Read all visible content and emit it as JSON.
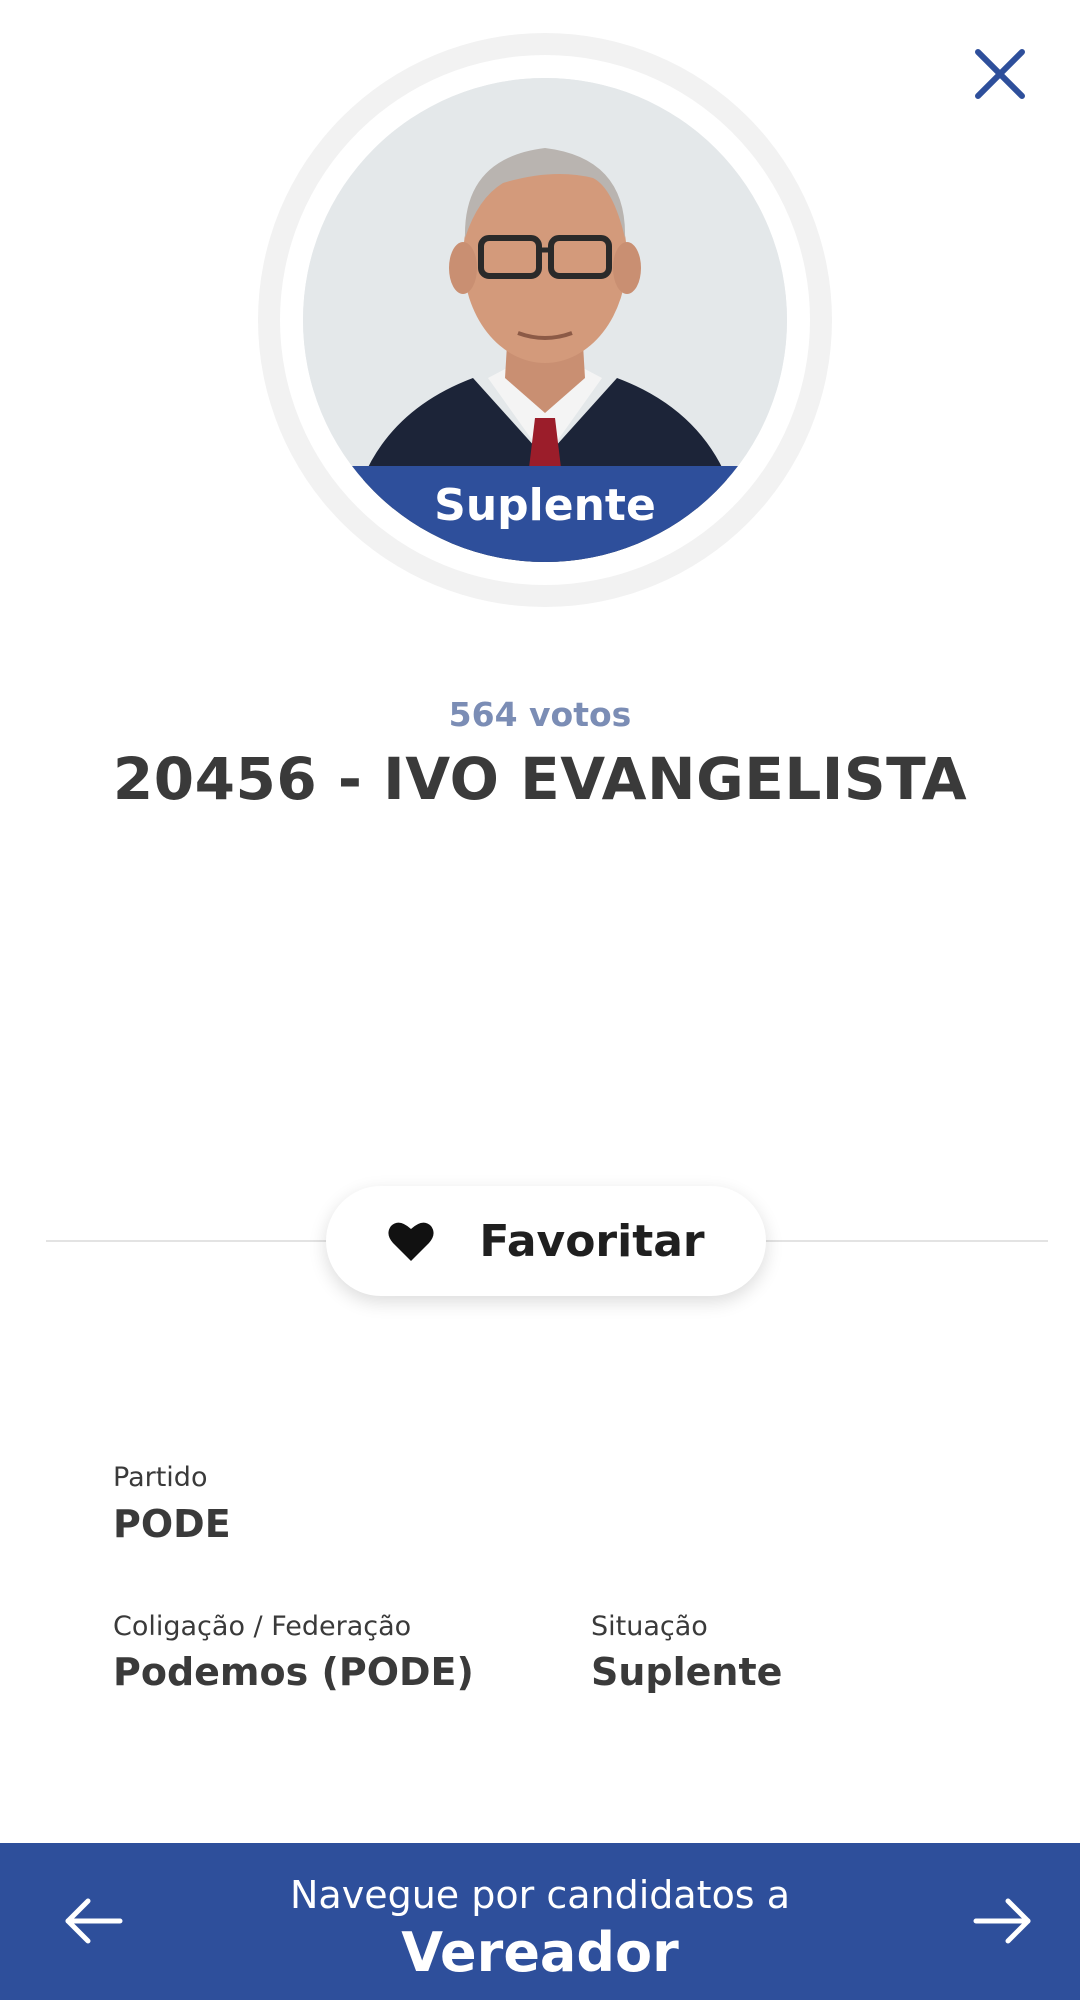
{
  "colors": {
    "brand_blue": "#2e4f9b",
    "votes_text": "#7b8db5",
    "heading_text": "#3a3a3a"
  },
  "header": {
    "close_icon": "close-icon"
  },
  "candidate": {
    "status_badge": "Suplente",
    "votes": "564 votos",
    "name": "20456 - IVO EVANGELISTA"
  },
  "favorite": {
    "icon": "heart-icon",
    "label": "Favoritar"
  },
  "details": {
    "party_label": "Partido",
    "party_value": "PODE",
    "coalition_label": "Coligação / Federação",
    "coalition_value": "Podemos (PODE)",
    "situation_label": "Situação",
    "situation_value": "Suplente"
  },
  "footer": {
    "subtitle": "Navegue por candidatos a",
    "title": "Vereador",
    "prev_icon": "arrow-left-icon",
    "next_icon": "arrow-right-icon"
  }
}
